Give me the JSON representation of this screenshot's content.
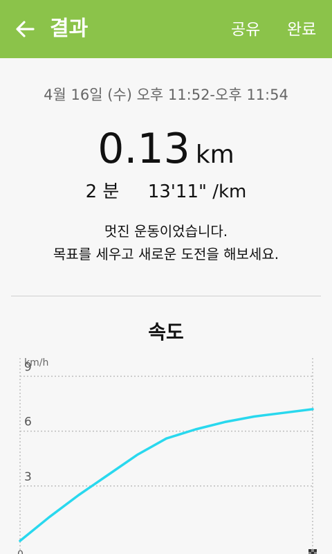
{
  "app_bar": {
    "title": "결과",
    "share_label": "공유",
    "done_label": "완료",
    "back_icon": "arrow-back-icon",
    "color": "#8bc34a"
  },
  "summary": {
    "datetime": "4월 16일 (수) 오후 11:52-오후 11:54",
    "distance_value": "0.13",
    "distance_unit": "km",
    "duration": "2 분",
    "pace": "13'11\" /km",
    "message_line1": "멋진 운동이었습니다.",
    "message_line2": "목표를 세우고 새로운 도전을 해보세요."
  },
  "chart_data": {
    "type": "line",
    "title": "속도",
    "ylabel": "km/h",
    "ylim": [
      0,
      10
    ],
    "y_ticks": [
      "3",
      "6",
      "9"
    ],
    "x_start_label": "0",
    "end_marker_icon": "finish-flag-icon",
    "grid": true,
    "line_color": "#29d8ee",
    "series": [
      {
        "values": [
          [
            0,
            0.0
          ],
          [
            0.1,
            1.3
          ],
          [
            0.2,
            2.5
          ],
          [
            0.3,
            3.6
          ],
          [
            0.4,
            4.7
          ],
          [
            0.5,
            5.6
          ],
          [
            0.6,
            6.1
          ],
          [
            0.7,
            6.5
          ],
          [
            0.8,
            6.8
          ],
          [
            0.9,
            7.0
          ],
          [
            1.0,
            7.2
          ]
        ]
      }
    ]
  }
}
